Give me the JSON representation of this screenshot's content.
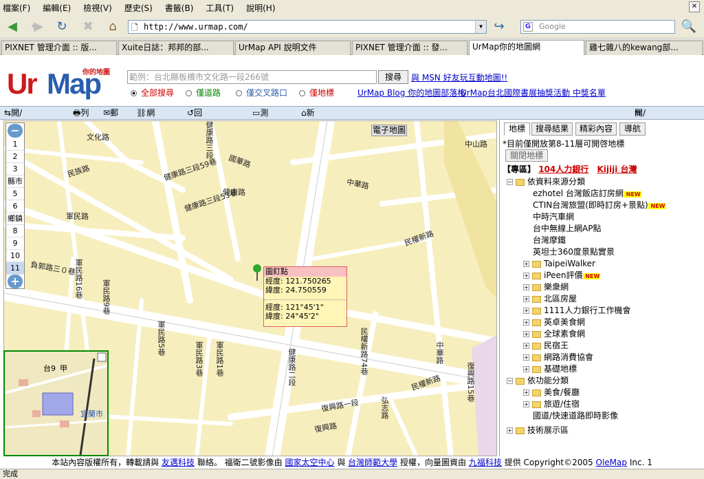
{
  "menu": [
    "檔案(F)",
    "編輯(E)",
    "檢視(V)",
    "歷史(S)",
    "書籤(B)",
    "工具(T)",
    "說明(H)"
  ],
  "address": {
    "url": "http://www.urmap.com/"
  },
  "browser_search": {
    "placeholder": "Google"
  },
  "tabs": [
    {
      "label": "PIXNET 管理介面 :: 版..."
    },
    {
      "label": "Xuite日誌：邦邦的部..."
    },
    {
      "label": "UrMap API 說明文件"
    },
    {
      "label": "PIXNET 管理介面 :: 發..."
    },
    {
      "label": "UrMap你的地圖網"
    },
    {
      "label": "雞七雜八的kewang部..."
    }
  ],
  "logo": {
    "text_ur": "Ur",
    "text_map": "Map",
    "tagline": "你的地圖"
  },
  "search": {
    "placeholder": "範例：台北縣板橋市文化路一段266號",
    "button": "搜尋",
    "msn_link": "與 MSN 好友玩互動地圖!!",
    "options": [
      "全部搜尋",
      "僅道路",
      "僅交叉路口",
      "僅地標"
    ],
    "blog_link": "UrMap Blog 你的地圖部落格",
    "event_link": "UrMap台北國際書展抽獎活動 中獎名單"
  },
  "toolbar": {
    "toggle_left": "開/關搜尋列",
    "print": "列印",
    "mail": "郵寄",
    "link": "網頁連結",
    "back": "回到原查詢點",
    "measure": "測量距離",
    "newaddr": "新增門牌地址(新版即將推出)",
    "toggle_right": "開/關搜尋列"
  },
  "map": {
    "estreet_button": "電子地圖",
    "zoom_levels": [
      "1",
      "2",
      "3",
      "縣市",
      "5",
      "6",
      "鄉鎮",
      "8",
      "9",
      "10",
      "11"
    ],
    "popup": {
      "title": "圖釘點",
      "lng": "經度: 121.750265",
      "lat": "緯度: 24.750559",
      "lng_dms": "經度: 121°45'1\"",
      "lat_dms": "緯度: 24°45'2\""
    },
    "streets": [
      "負郭路三０巷",
      "文化路",
      "民族路",
      "健康路三段59巷",
      "健康路",
      "健康路三段53巷",
      "國華路",
      "中華路",
      "軍民路",
      "民權新路",
      "民權新路",
      "民權新路",
      "軍民路16巷",
      "軍民路9巷",
      "軍民路5巷",
      "軍民路3巷",
      "軍民路1巷",
      "健康路二段",
      "中華路",
      "復興路一段",
      "復興路15巷",
      "弘志路",
      "復興路",
      "中山路",
      "健康路三段",
      "民權新路74巷",
      "民權新路"
    ],
    "overview_labels": [
      "台9",
      "甲",
      "宜蘭市"
    ]
  },
  "panel": {
    "tabs": [
      "地標",
      "搜尋結果",
      "精彩內容",
      "導航"
    ],
    "notice": "*目前僅開放第8-11層可開啓地標",
    "close_button": "關閉地標",
    "promo_prefix": "【專區】",
    "promo_link1": "104人力銀行",
    "promo_link2": "Kijiji 台灣",
    "tree": [
      {
        "label": "依資料來源分類",
        "type": "open-folder"
      },
      {
        "label": "ezhotel 台灣飯店訂房網",
        "type": "item",
        "new": true
      },
      {
        "label": "CTIN台灣旅盟(即時訂房+景點)",
        "type": "item",
        "new": true
      },
      {
        "label": "中時汽車網",
        "type": "item"
      },
      {
        "label": "台中無線上網AP點",
        "type": "item"
      },
      {
        "label": "台灣摩鐵",
        "type": "item"
      },
      {
        "label": "英坦士360度景點實景",
        "type": "item"
      },
      {
        "label": "TaipeiWalker",
        "type": "folder"
      },
      {
        "label": "iPeen評價",
        "type": "folder",
        "new": true
      },
      {
        "label": "樂衆網",
        "type": "folder"
      },
      {
        "label": "北區房屋",
        "type": "folder"
      },
      {
        "label": "1111人力銀行工作機會",
        "type": "folder"
      },
      {
        "label": "英卓美食網",
        "type": "folder"
      },
      {
        "label": "全球素食網",
        "type": "folder"
      },
      {
        "label": "民宿王",
        "type": "folder"
      },
      {
        "label": "網路消費協會",
        "type": "folder"
      },
      {
        "label": "基礎地標",
        "type": "folder"
      },
      {
        "label": "依功能分類",
        "type": "open-folder"
      },
      {
        "label": "美食/餐廳",
        "type": "folder"
      },
      {
        "label": "旅遊/住宿",
        "type": "folder"
      },
      {
        "label": "國道/快速道路即時影像",
        "type": "item"
      },
      {
        "label": "技術展示區",
        "type": "top-folder"
      }
    ],
    "new_badge": "NEW"
  },
  "footer": {
    "t1": "本站內容版權所有，轉載請與",
    "l1": "友邁科技",
    "t2": "聯絡。 福衛二號影像由",
    "l2": "國家太空中心",
    "t3": "與",
    "l3": "台灣師範大學",
    "t4": "授權，向量圖資由",
    "l4": "九福科技",
    "t5": "提供 Copyright©2005",
    "l5": "OleMap",
    "t6": "Inc. 1"
  },
  "status": "完成"
}
